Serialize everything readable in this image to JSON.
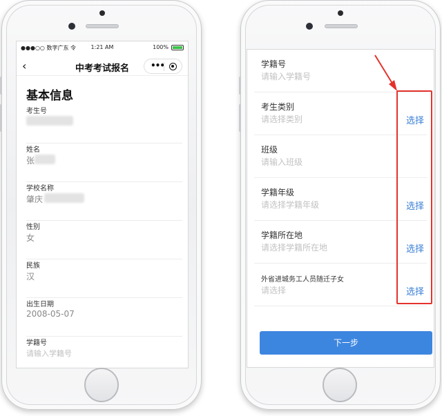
{
  "left_phone": {
    "status": {
      "carrier": "●●●○○ 数字广东 令",
      "time": "1:21 AM",
      "battery": "100%"
    },
    "nav": {
      "back": "‹",
      "title": "中考考试报名",
      "menu_dots": "•••"
    },
    "section_title": "基本信息",
    "fields": [
      {
        "label": "考生号",
        "value": ""
      },
      {
        "label": "姓名",
        "value": "张"
      },
      {
        "label": "学校名称",
        "value": "肇庆"
      },
      {
        "label": "性别",
        "value": "女"
      },
      {
        "label": "民族",
        "value": "汉"
      },
      {
        "label": "出生日期",
        "value": "2008-05-07"
      },
      {
        "label": "学籍号",
        "placeholder": "请输入学籍号"
      }
    ]
  },
  "right_phone": {
    "fields": [
      {
        "label": "学籍号",
        "placeholder": "请输入学籍号",
        "action": ""
      },
      {
        "label": "考生类别",
        "placeholder": "请选择类别",
        "action": "选择"
      },
      {
        "label": "班级",
        "placeholder": "请输入班级",
        "action": ""
      },
      {
        "label": "学籍年级",
        "placeholder": "请选择学籍年级",
        "action": "选择"
      },
      {
        "label": "学籍所在地",
        "placeholder": "请选择学籍所在地",
        "action": "选择"
      },
      {
        "label": "外省进城务工人员随迁子女",
        "placeholder": "请选择",
        "action": "选择"
      }
    ],
    "next_button": "下一步"
  },
  "colors": {
    "accent": "#3d86e0",
    "link": "#3a7fd5",
    "annotation": "#e4312b"
  }
}
